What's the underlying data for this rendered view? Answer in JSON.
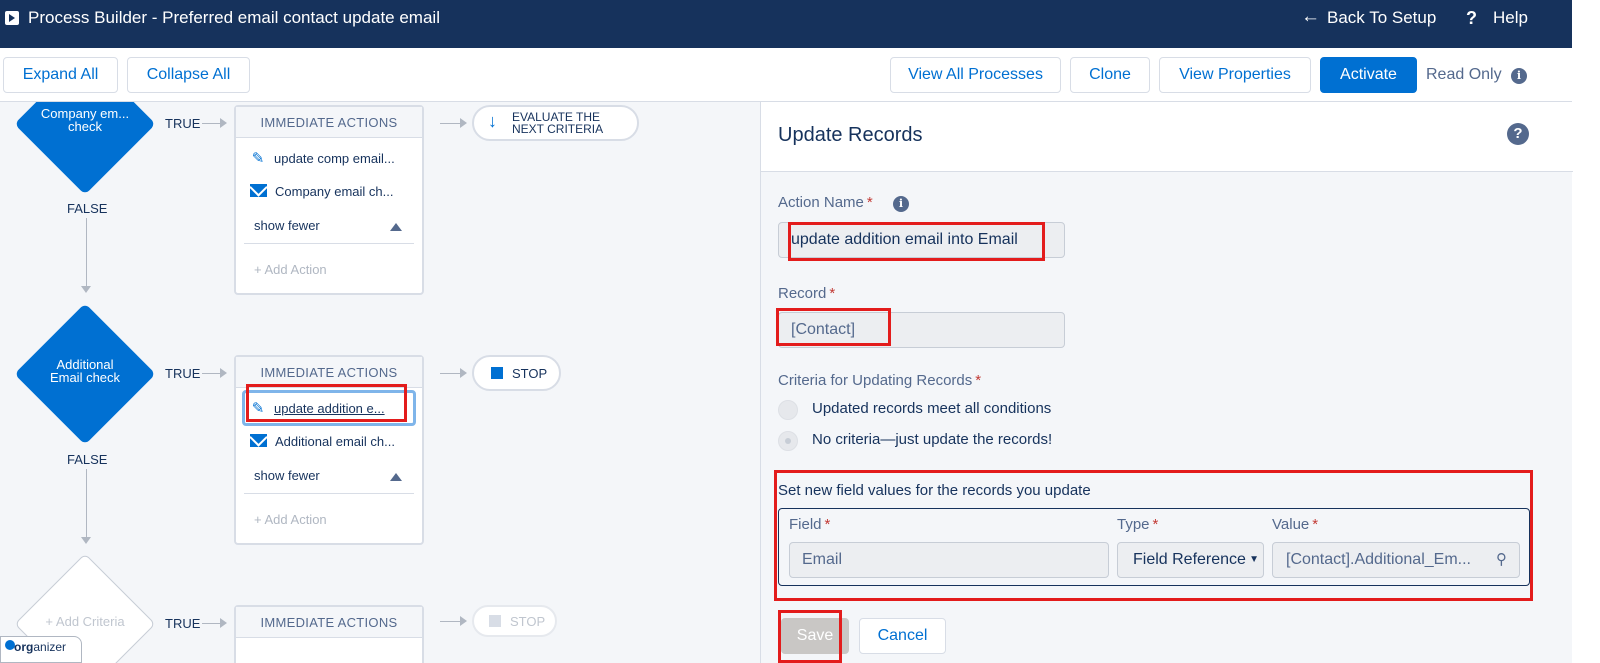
{
  "header": {
    "title": "Process Builder - Preferred email contact update email",
    "back_label": "Back To Setup",
    "help_label": "Help"
  },
  "toolbar": {
    "expand_all": "Expand All",
    "collapse_all": "Collapse All",
    "view_all_processes": "View All Processes",
    "clone": "Clone",
    "view_properties": "View Properties",
    "activate": "Activate",
    "read_only": "Read Only"
  },
  "canvas": {
    "criteria": [
      {
        "label_line1": "Company em...",
        "label_line2": "check",
        "true_label": "TRUE",
        "false_label": "FALSE"
      },
      {
        "label_line1": "Additional",
        "label_line2": "Email check",
        "true_label": "TRUE",
        "false_label": "FALSE"
      },
      {
        "label": "Add Criteria",
        "true_label": "TRUE"
      }
    ],
    "action_groups": [
      {
        "header": "IMMEDIATE ACTIONS",
        "actions": [
          "update comp email...",
          "Company email ch..."
        ],
        "show_fewer": "show fewer",
        "add_action": "Add Action",
        "end_line1": "EVALUATE THE",
        "end_line2": "NEXT CRITERIA"
      },
      {
        "header": "IMMEDIATE ACTIONS",
        "actions": [
          "update addition e...",
          "Additional email ch..."
        ],
        "show_fewer": "show fewer",
        "add_action": "Add Action",
        "end_label": "STOP"
      },
      {
        "header": "IMMEDIATE ACTIONS",
        "end_label": "STOP"
      }
    ],
    "organizer_prefix": "org",
    "organizer_rest": "anizer"
  },
  "panel": {
    "title": "Update Records",
    "action_name_label": "Action Name",
    "action_name_value": "update addition email into Email",
    "record_label": "Record",
    "record_value": "[Contact]",
    "criteria_label": "Criteria for Updating Records",
    "criteria_options": [
      "Updated records meet all conditions",
      "No criteria—just update the records!"
    ],
    "set_values_label": "Set new field values for the records you update",
    "field_header": "Field",
    "type_header": "Type",
    "value_header": "Value",
    "field_value": "Email",
    "type_value": "Field Reference",
    "value_value": "[Contact].Additional_Em...",
    "save": "Save",
    "cancel": "Cancel"
  },
  "colors": {
    "header_bg": "#16325c",
    "brand_blue": "#0070d2",
    "annotation_red": "#e31c1c"
  }
}
